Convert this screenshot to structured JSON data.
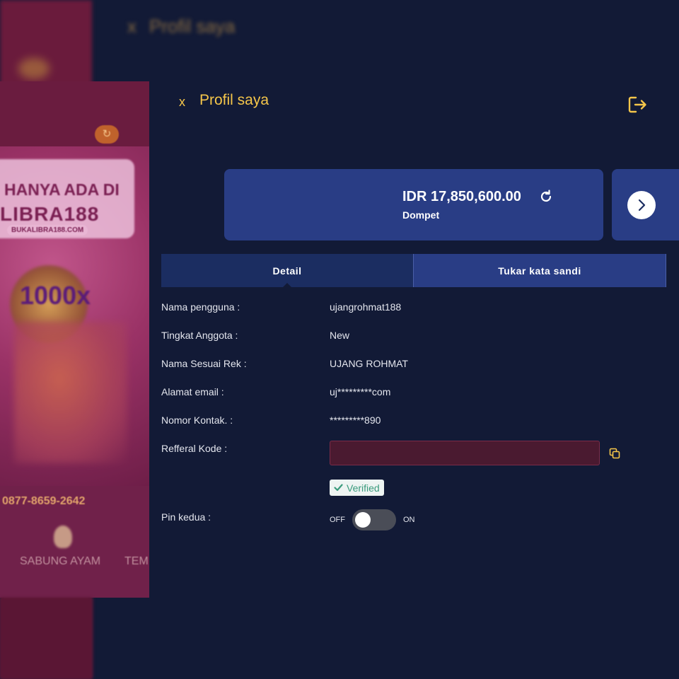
{
  "background": {
    "title": "Profil saya",
    "promo": {
      "line1": "HANYA ADA DI",
      "line2": "LIBRA188",
      "url": "BUKALIBRA188.COM",
      "badge": "1000x",
      "phone": "0877-8659-2642",
      "nav_items": [
        "SABUNG AYAM",
        "TEM"
      ]
    }
  },
  "header": {
    "close_label": "x",
    "title": "Profil saya",
    "logout_icon": "logout-icon"
  },
  "wallet": {
    "amount": "IDR 17,850,600.00",
    "label": "Dompet"
  },
  "tabs": [
    {
      "label": "Detail",
      "active": true
    },
    {
      "label": "Tukar kata sandi",
      "active": false
    }
  ],
  "details": {
    "username": {
      "label": "Nama pengguna :",
      "value": "ujangrohmat188"
    },
    "member_level": {
      "label": "Tingkat Anggota :",
      "value": "New"
    },
    "account_name": {
      "label": "Nama Sesuai Rek :",
      "value": "UJANG ROHMAT"
    },
    "email": {
      "label": "Alamat email :",
      "value": "uj*********com"
    },
    "phone": {
      "label": "Nomor Kontak. :",
      "value": "*********890"
    },
    "referral": {
      "label": "Refferal Kode :",
      "value": ""
    },
    "pin": {
      "label": "Pin kedua :",
      "off_label": "OFF",
      "on_label": "ON",
      "enabled": false
    }
  },
  "verified_label": "Verified",
  "colors": {
    "accent": "#f5c64a",
    "background": "#121a36",
    "card": "#293d85",
    "verified": "#3a9b7c"
  }
}
